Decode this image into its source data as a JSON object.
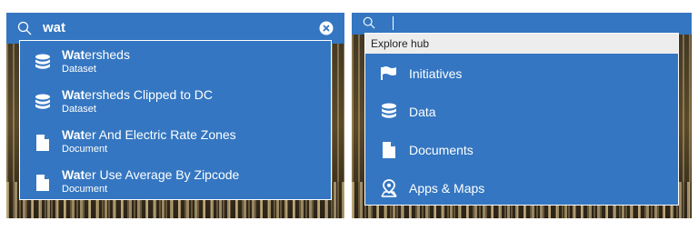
{
  "left": {
    "search_query": "wat",
    "results": [
      {
        "match": "Wat",
        "rest": "ersheds",
        "type": "Dataset",
        "icon": "database-icon"
      },
      {
        "match": "Wat",
        "rest": "ersheds Clipped to DC",
        "type": "Dataset",
        "icon": "database-icon"
      },
      {
        "match": "Wat",
        "rest": "er And Electric Rate Zones",
        "type": "Document",
        "icon": "document-icon"
      },
      {
        "match": "Wat",
        "rest": "er Use Average By Zipcode",
        "type": "Document",
        "icon": "document-icon"
      }
    ]
  },
  "right": {
    "search_query": "",
    "header": "Explore hub",
    "items": [
      {
        "label": "Initiatives",
        "icon": "flag-icon"
      },
      {
        "label": "Data",
        "icon": "database-icon"
      },
      {
        "label": "Documents",
        "icon": "document-icon"
      },
      {
        "label": "Apps & Maps",
        "icon": "map-pin-icon"
      }
    ]
  },
  "colors": {
    "accent": "#3476c1",
    "header_bg": "#ededed"
  }
}
